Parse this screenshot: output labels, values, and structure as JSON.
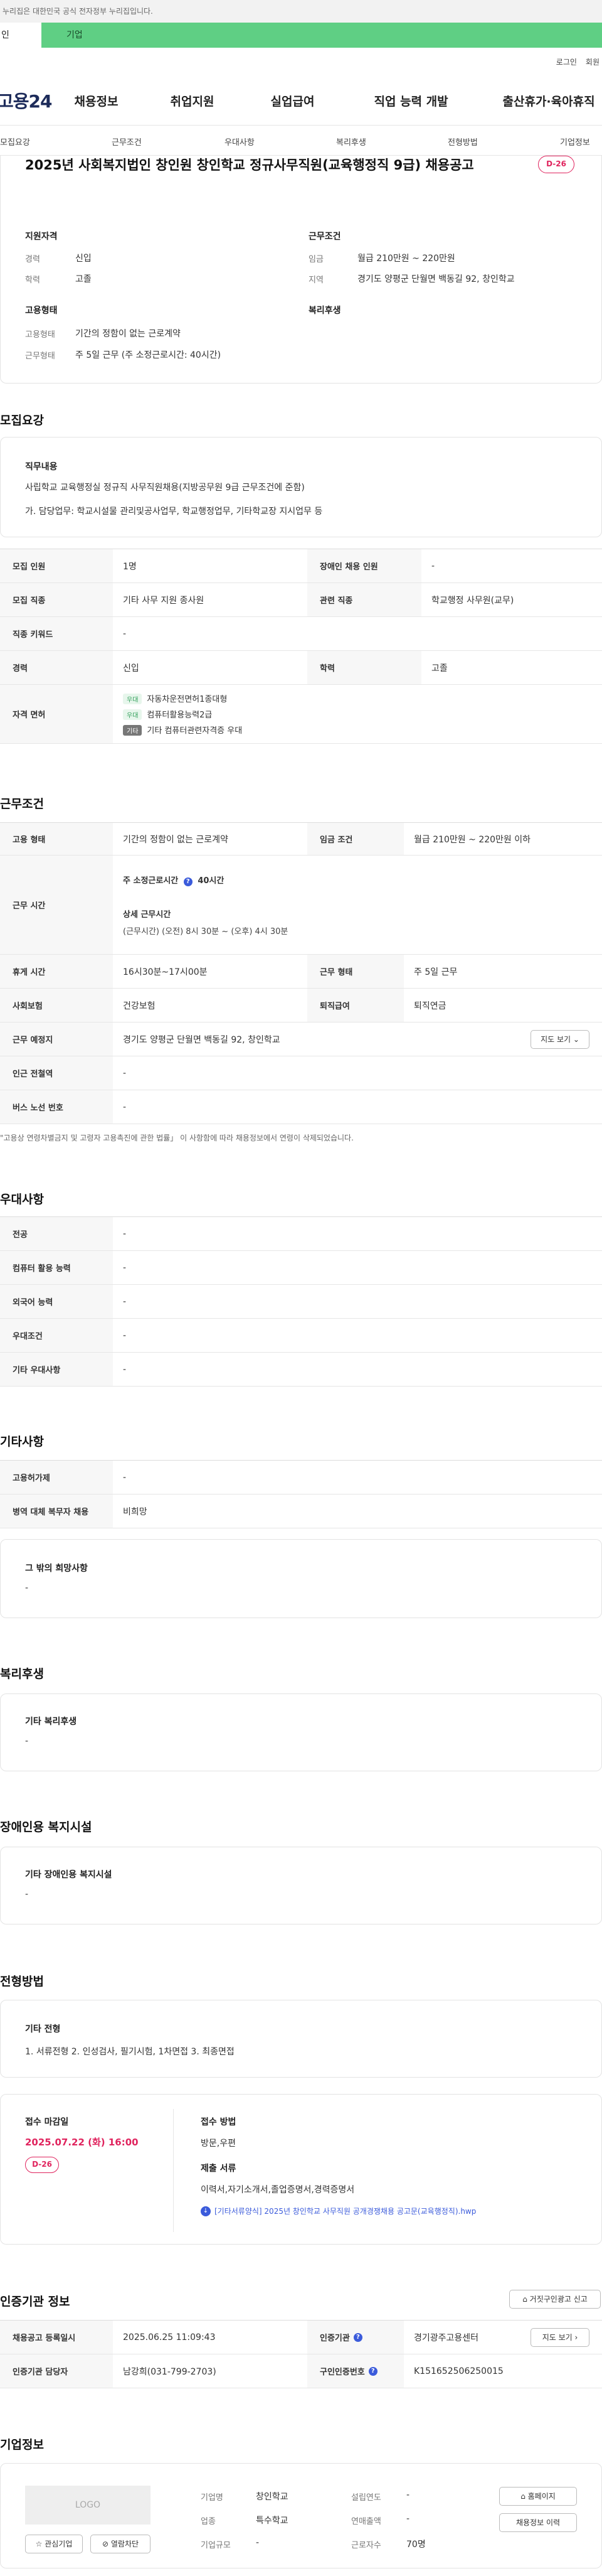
{
  "gov_notice": "누리집은 대한민국 공식 전자정부 누리집입니다.",
  "tabs": {
    "personal": "인",
    "company": "기업"
  },
  "util": {
    "login": "로그인",
    "join": "회원"
  },
  "logo": "고용24",
  "gnb": [
    "채용정보",
    "취업지원",
    "실업급여",
    "직업 능력 개발",
    "출산휴가·육아휴직"
  ],
  "subnav": [
    "모집요강",
    "근무조건",
    "우대사항",
    "복리후생",
    "전형방법",
    "기업정보"
  ],
  "job": {
    "title": "2025년 사회복지법인 창인원 창인학교 정규사무직원(교육행정직 9급) 채용공고",
    "dday": "D-26"
  },
  "summary": {
    "qual_title": "지원자격",
    "career_label": "경력",
    "career_value": "신입",
    "edu_label": "학력",
    "edu_value": "고졸",
    "work_title": "근무조건",
    "wage_label": "임금",
    "wage_value": "월급 210만원 ~ 220만원",
    "region_label": "지역",
    "region_value": "경기도 양평군 단월면 백동길 92, 창인학교",
    "emp_title": "고용형태",
    "emp_type_label": "고용형태",
    "emp_type_value": "기간의 정함이 없는 근로계약",
    "work_type_label": "근무형태",
    "work_type_value": "주 5일 근무 (주 소정근로시간: 40시간)",
    "welfare_title": "복리후생"
  },
  "recruit": {
    "section": "모집요강",
    "duty_title": "직무내용",
    "duty_line1": "사립학교 교육행정실 정규직 사무직원채용(지방공무원 9급 근무조건에 준함)",
    "duty_line2": "가. 담당업무: 학교시설물 관리및공사업무, 학교행정업무, 기타학교장 지시업무 등",
    "rows": {
      "count_label": "모집 인원",
      "count_value": "1명",
      "disabled_label": "장애인 채용 인원",
      "disabled_value": "-",
      "job_label": "모집 직종",
      "job_value": "기타 사무 지원 종사원",
      "related_label": "관련 직종",
      "related_value": "학교행정 사무원(교무)",
      "keyword_label": "직종 키워드",
      "keyword_value": "-",
      "career_label": "경력",
      "career_value": "신입",
      "edu_label": "학력",
      "edu_value": "고졸",
      "license_label": "자격 면허",
      "licenses": [
        {
          "tag": "우대",
          "name": "자동차운전면허1종대형"
        },
        {
          "tag": "우대",
          "name": "컴퓨터활용능력2급"
        },
        {
          "tag": "기타",
          "name": "기타 컴퓨터관련자격증 우대"
        }
      ]
    }
  },
  "work": {
    "section": "근무조건",
    "emp_label": "고용 형태",
    "emp_value": "기간의 정함이 없는 근로계약",
    "wage_label": "임금 조건",
    "wage_value": "월급 210만원 ~ 220만원 이하",
    "hours_label": "근무 시간",
    "weekly_hours": "주 소정근로시간",
    "weekly_hours_value": "40시간",
    "detail_title": "상세 근무시간",
    "detail_value": "(근무시간) (오전) 8시 30분 ~ (오후) 4시 30분",
    "break_label": "휴게 시간",
    "break_value": "16시30분~17시00분",
    "worktype_label": "근무 형태",
    "worktype_value": "주 5일 근무",
    "insurance_label": "사회보험",
    "insurance_value": "건강보험",
    "pension_label": "퇴직급여",
    "pension_value": "퇴직연금",
    "place_label": "근무 예정지",
    "place_value": "경기도 양평군 단월면 백동길 92, 창인학교",
    "map_btn": "지도 보기",
    "station_label": "인근 전철역",
    "station_value": "-",
    "bus_label": "버스 노선 번호",
    "bus_value": "-",
    "note": "\"고용상 연령차별금지 및 고령자 고용촉진에 관한 법률」 이 사항함에 따라 채용정보에서 연령이 삭제되었습니다."
  },
  "pref": {
    "section": "우대사항",
    "major_label": "전공",
    "major_value": "-",
    "computer_label": "컴퓨터 활용 능력",
    "computer_value": "-",
    "lang_label": "외국어 능력",
    "lang_value": "-",
    "cond_label": "우대조건",
    "cond_value": "-",
    "etc_label": "기타 우대사항",
    "etc_value": "-"
  },
  "other": {
    "section": "기타사항",
    "permit_label": "고용허가제",
    "permit_value": "-",
    "military_label": "병역 대체 복무자 채용",
    "military_value": "비희망",
    "extra_title": "그 밖의 희망사항",
    "extra_value": "-"
  },
  "welfare": {
    "section": "복리후생",
    "title": "기타 복리후생",
    "value": "-"
  },
  "facility": {
    "section": "장애인용 복지시설",
    "title": "기타 장애인용 복지시설",
    "value": "-"
  },
  "process": {
    "section": "전형방법",
    "title": "기타 전형",
    "value": "1. 서류전형 2. 인성검사, 필기시험, 1차면접 3. 최종면접",
    "deadline_title": "접수 마감일",
    "deadline_value": "2025.07.22 (화) 16:00",
    "dday": "D-26",
    "method_title": "접수 방법",
    "method_value": "방문,우편",
    "docs_title": "제출 서류",
    "docs_value": "이력서,자기소개서,졸업증명서,경력증명서",
    "attach": "[기타서류양식] 2025년 창인학교 사무직원 공개경쟁채용 공고문(교육행정직).hwp"
  },
  "agency": {
    "section": "인증기관 정보",
    "report_btn": "거짓구인광고 신고",
    "reg_label": "채용공고 등록일시",
    "reg_value": "2025.06.25 11:09:43",
    "agency_label": "인증기관",
    "agency_value": "경기광주고용센터",
    "map_btn": "지도 보기",
    "manager_label": "인증기관 담당자",
    "manager_value": "남강희(031-799-2703)",
    "id_label": "구인인증번호",
    "id_value": "K151652506250015"
  },
  "company": {
    "section": "기업정보",
    "logo": "LOGO",
    "name_label": "기업명",
    "name_value": "창인학교",
    "founded_label": "설립연도",
    "founded_value": "-",
    "industry_label": "업종",
    "industry_value": "특수학교",
    "revenue_label": "연매출액",
    "revenue_value": "-",
    "size_label": "기업규모",
    "size_value": "-",
    "staff_label": "근로자수",
    "staff_value": "70명",
    "homepage_btn": "홈페이지",
    "jobs_btn": "채용정보 이력",
    "fav_btn": "관심기업",
    "block_btn": "열람차단"
  },
  "colors": {
    "accent": "#e0245e",
    "tab_green": "#5fcf84",
    "link_blue": "#3b5bdb"
  }
}
